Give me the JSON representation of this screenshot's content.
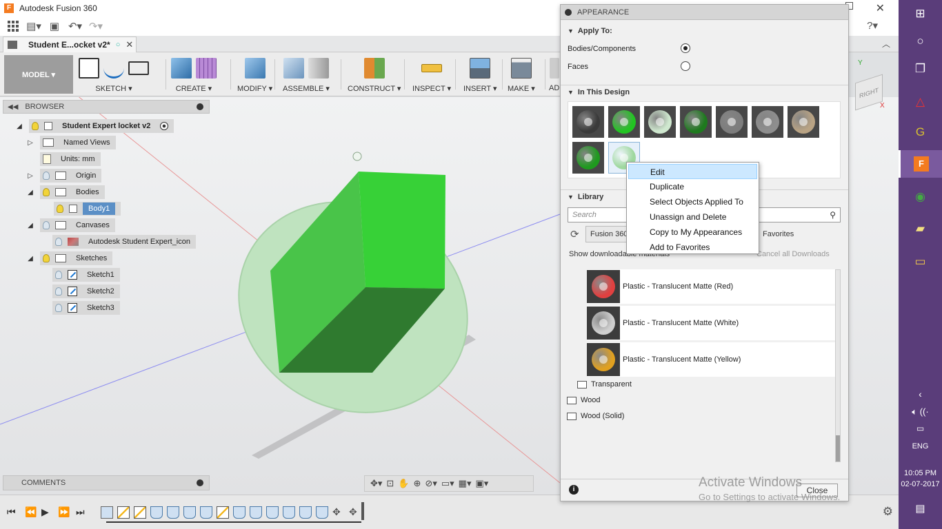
{
  "window": {
    "title": "Autodesk Fusion 360",
    "app_icon": "F"
  },
  "document_tab": {
    "label": "Student E...ocket v2*"
  },
  "ribbon": {
    "workspace": "MODEL ▾",
    "groups": [
      "SKETCH ▾",
      "CREATE ▾",
      "MODIFY ▾",
      "ASSEMBLE ▾",
      "CONSTRUCT ▾",
      "INSPECT ▾",
      "INSERT ▾",
      "MAKE ▾",
      "AD"
    ]
  },
  "browser": {
    "title": "BROWSER",
    "root": "Student Expert locket v2",
    "named_views": "Named Views",
    "units": "Units: mm",
    "origin": "Origin",
    "bodies": "Bodies",
    "body1": "Body1",
    "canvases": "Canvases",
    "canvas_item": "Autodesk Student Expert_icon",
    "sketches": "Sketches",
    "sketch1": "Sketch1",
    "sketch2": "Sketch2",
    "sketch3": "Sketch3"
  },
  "comments": {
    "title": "COMMENTS"
  },
  "appearance": {
    "title": "APPEARANCE",
    "apply_to": "Apply To:",
    "opt_bodies": "Bodies/Components",
    "opt_faces": "Faces",
    "in_design": "In This Design",
    "swatch_colors": [
      "#3a3a3a",
      "#22c422",
      "#cfe8cf",
      "#1e7a1e",
      "#7d7d7d",
      "#8e8e8e",
      "#b9a384",
      "#1f9a1f",
      "#9fd89f"
    ],
    "library": "Library",
    "search_placeholder": "Search",
    "lib_tab_fusion": "Fusion 360",
    "lib_tab_favorites": "Favorites",
    "show_downloads": "Show downloadable materials",
    "cancel_downloads": "Cancel all Downloads",
    "items": [
      {
        "label": "Plastic - Translucent Matte (Red)",
        "color": "#e04040"
      },
      {
        "label": "Plastic - Translucent Matte (White)",
        "color": "#cfcfcf"
      },
      {
        "label": "Plastic - Translucent Matte (Yellow)",
        "color": "#e0a020"
      }
    ],
    "folders": [
      "Transparent",
      "Wood",
      "Wood (Solid)"
    ],
    "close": "Close",
    "info": "i"
  },
  "context_menu": [
    "Edit",
    "Duplicate",
    "Select Objects Applied To",
    "Unassign and Delete",
    "Copy to My Appearances",
    "Add to Favorites"
  ],
  "watermark": {
    "line1": "Activate Windows",
    "line2": "Go to Settings to activate Windows."
  },
  "taskbar": {
    "lang": "ENG",
    "time": "10:05 PM",
    "date": "02-07-2017"
  },
  "colors": {
    "accent_blue": "#5b8fc6",
    "taskbar": "#5a3d7a",
    "body_green": "#3cc43c"
  }
}
